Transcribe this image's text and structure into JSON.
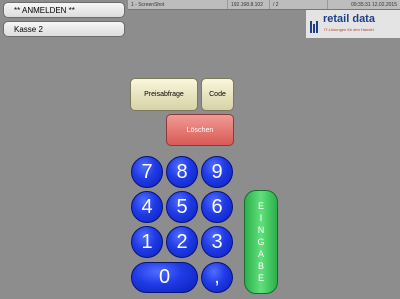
{
  "session": {
    "login_label": "** ANMELDEN **",
    "register_label": "Kasse 2"
  },
  "status_bar": {
    "screen_name": "1 - ScreenShot",
    "ip": "192.168.8.102",
    "page": "/     2",
    "datetime": "09:35:31 12.02.2015"
  },
  "logo": {
    "title": "retail data",
    "subtitle": "IT-Lösungen für den Handel"
  },
  "functions": {
    "price_check": "Preisabfrage",
    "code": "Code",
    "delete": "Löschen"
  },
  "keypad": {
    "keys": [
      "7",
      "8",
      "9",
      "4",
      "5",
      "6",
      "1",
      "2",
      "3"
    ],
    "zero": "0",
    "comma": ",",
    "enter_letters": [
      "E",
      "I",
      "N",
      "G",
      "A",
      "B",
      "E"
    ]
  },
  "colors": {
    "background": "#8d8d8d",
    "key_blue": "#1f3ae6",
    "enter_green": "#3cc75a",
    "delete_red": "#e06a65",
    "brand_blue": "#1e3f8a"
  }
}
